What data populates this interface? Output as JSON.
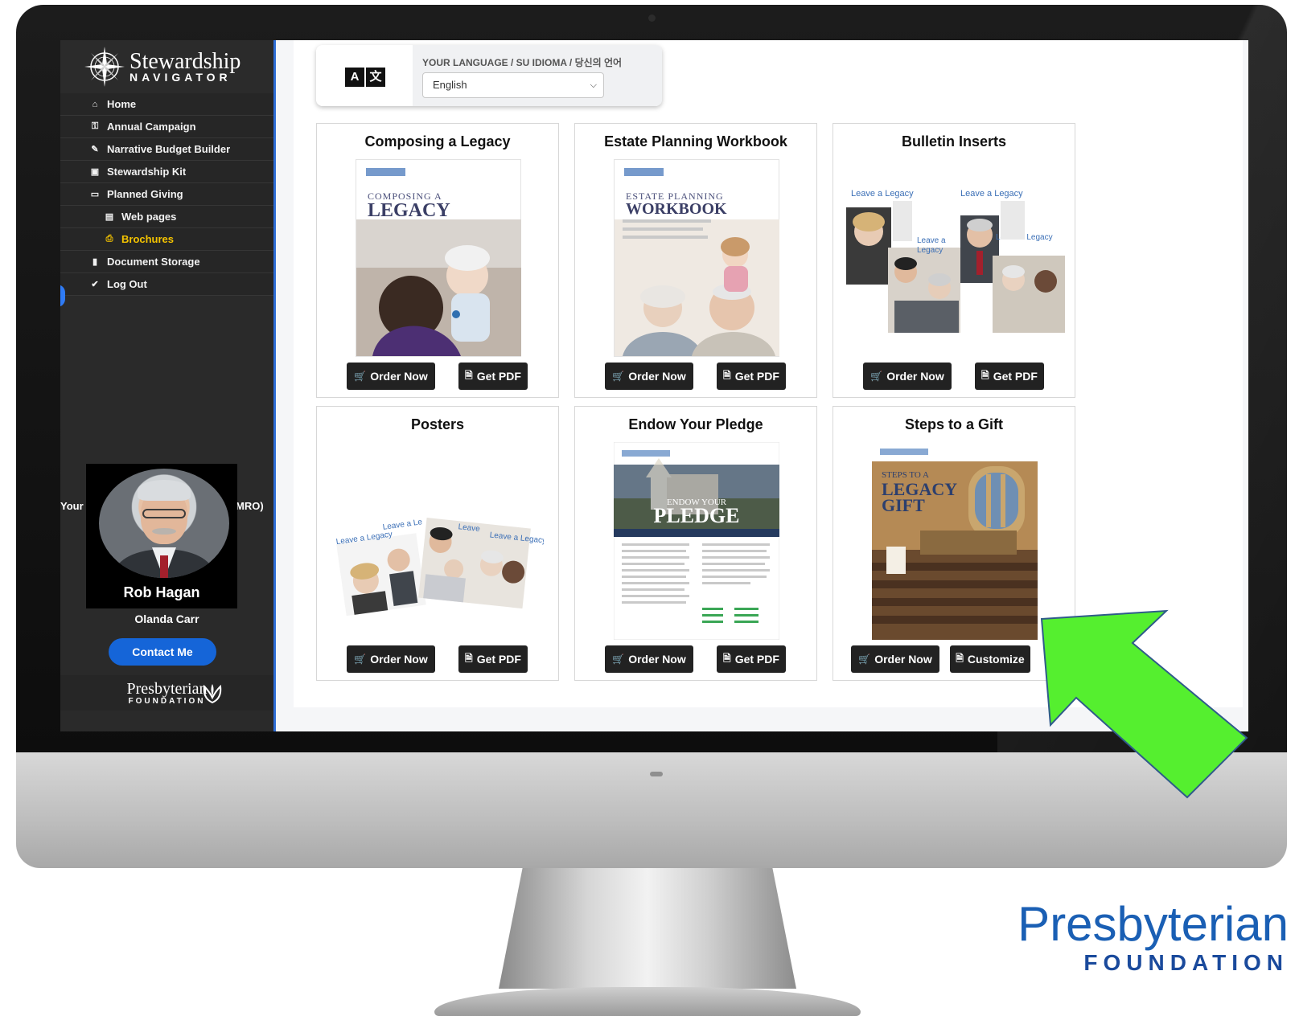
{
  "sidebar": {
    "brand": {
      "line1": "Stewardship",
      "line2": "NAVIGATOR"
    },
    "items": [
      {
        "label": "Home",
        "icon": "home-icon",
        "glyph": "⌂"
      },
      {
        "label": "Annual Campaign",
        "icon": "key-icon",
        "glyph": "⚿"
      },
      {
        "label": "Narrative Budget Builder",
        "icon": "pencil-icon",
        "glyph": "✎"
      },
      {
        "label": "Stewardship Kit",
        "icon": "images-icon",
        "glyph": "▣"
      },
      {
        "label": "Planned Giving",
        "icon": "calendar-icon",
        "glyph": "▭"
      },
      {
        "label": "Web pages",
        "icon": "window-icon",
        "glyph": "▤"
      },
      {
        "label": "Brochures",
        "icon": "print-icon",
        "glyph": "⎙"
      },
      {
        "label": "Document Storage",
        "icon": "bookmark-icon",
        "glyph": "▮"
      },
      {
        "label": "Log Out",
        "icon": "shield-check-icon",
        "glyph": "✔"
      }
    ],
    "profile": {
      "row_left": "Your",
      "row_right": "MRO)",
      "name": "Rob Hagan",
      "subname": "Olanda Carr",
      "contact_label": "Contact Me"
    },
    "footer": {
      "line1": "Presbyterian",
      "line2": "FOUNDATION"
    }
  },
  "language": {
    "label": "YOUR LANGUAGE / SU IDIOMA / 당신의 언어",
    "selected": "English",
    "icon_glyphs": [
      "A",
      "文"
    ]
  },
  "cards": [
    {
      "title": "Composing a Legacy",
      "cover_small": "COMPOSING A",
      "cover_big": "LEGACY",
      "buttons": [
        "Order Now",
        "Get PDF"
      ]
    },
    {
      "title": "Estate Planning Workbook",
      "cover_small": "ESTATE PLANNING",
      "cover_big": "WORKBOOK",
      "buttons": [
        "Order Now",
        "Get PDF"
      ]
    },
    {
      "title": "Bulletin Inserts",
      "cover_small": "Leave a Legacy",
      "cover_big": "Leave a Legacy",
      "buttons": [
        "Order Now",
        "Get PDF"
      ]
    },
    {
      "title": "Posters",
      "cover_small": "Leave a Legacy",
      "cover_big": "Leave a Le",
      "buttons": [
        "Order Now",
        "Get PDF"
      ]
    },
    {
      "title": "Endow Your Pledge",
      "cover_small": "ENDOW YOUR",
      "cover_big": "PLEDGE",
      "buttons": [
        "Order Now",
        "Get PDF"
      ]
    },
    {
      "title": "Steps to a Gift",
      "cover_small": "STEPS TO A",
      "cover_big": "LEGACY GIFT",
      "buttons": [
        "Order Now",
        "Customize"
      ]
    }
  ],
  "watermark": {
    "line1": "Presbyterian",
    "line2": "FOUNDATION"
  },
  "colors": {
    "sidebar": "#2a2a2a",
    "accent_blue": "#1565d8",
    "active_item": "#f5c400",
    "arrow_green": "#55ef2f",
    "brand_blue": "#1a5fb4"
  }
}
